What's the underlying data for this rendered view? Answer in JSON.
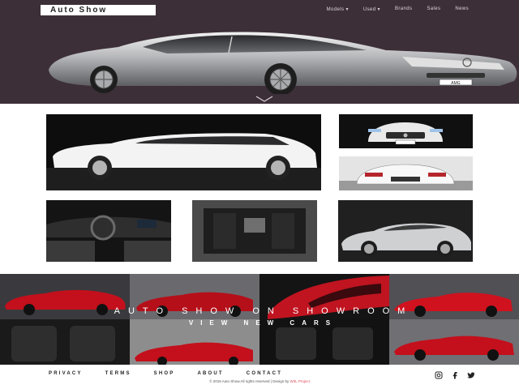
{
  "header": {
    "logo_text": "Auto Show",
    "nav": [
      {
        "label": "Models",
        "has_dropdown": true
      },
      {
        "label": "Used",
        "has_dropdown": true
      },
      {
        "label": "Brands",
        "has_dropdown": false
      },
      {
        "label": "Sales",
        "has_dropdown": false
      },
      {
        "label": "News",
        "has_dropdown": false
      }
    ],
    "plate_text": "AMG"
  },
  "showroom": {
    "title": "AUTO SHOW ON SHOWROOM",
    "cta": "VIEW NEW CARS"
  },
  "footer": {
    "links": [
      "PRIVACY",
      "TERMS",
      "SHOP",
      "ABOUT",
      "CONTACT"
    ],
    "copyright": "© 2016 Auto Show.All rights reserved | Design by",
    "credit": "W3L Project",
    "social": [
      "instagram-icon",
      "facebook-icon",
      "twitter-icon"
    ]
  },
  "colors": {
    "hero_bg": "#3d2f38",
    "accent": "#e04b5e",
    "showroom_bg": "#1b1b1b",
    "car_red": "#c3101c",
    "car_silver": "#bfc2c6"
  }
}
